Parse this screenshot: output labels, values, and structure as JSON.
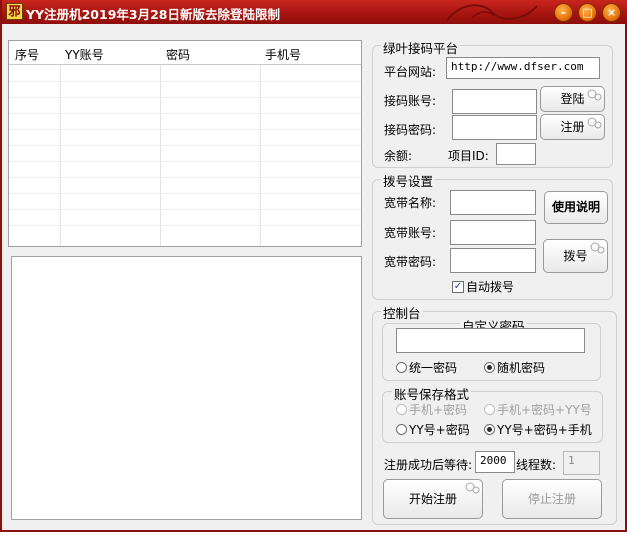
{
  "window": {
    "title": "YY注册机2019年3月28日新版去除登陆限制",
    "icon_glyph": "邪",
    "min_glyph": "–",
    "max_glyph": "□",
    "close_glyph": "×"
  },
  "grid": {
    "columns": [
      "序号",
      "YY账号",
      "密码",
      "手机号"
    ]
  },
  "platform": {
    "legend": "绿叶接码平台",
    "url_label": "平台网站:",
    "url_value": "http://www.dfser.com",
    "account_label": "接码账号:",
    "account_value": "",
    "password_label": "接码密码:",
    "password_value": "",
    "login_button": "登陆",
    "register_button": "注册",
    "balance_label": "余额:",
    "project_label": "项目ID:",
    "project_value": ""
  },
  "dial": {
    "legend": "拨号设置",
    "name_label": "宽带名称:",
    "account_label": "宽带账号:",
    "password_label": "宽带密码:",
    "help_button": "使用说明",
    "dial_button": "拨号",
    "auto_dial_label": "自动拨号",
    "auto_dial_checked": true,
    "check_glyph": "✓"
  },
  "console": {
    "legend": "控制台",
    "custom_password_label": "自定义密码",
    "custom_password_value": "",
    "uniform_password_label": "统一密码",
    "random_password_label": "随机密码",
    "password_mode": "random",
    "format_legend": "账号保存格式",
    "format_options": [
      "手机+密码",
      "手机+密码+YY号",
      "YY号+密码",
      "YY号+密码+手机"
    ],
    "format_selected": "YY号+密码+手机",
    "wait_label": "注册成功后等待:",
    "wait_value": "2000",
    "threads_label": "线程数:",
    "threads_value": "1",
    "start_button": "开始注册",
    "stop_button": "停止注册"
  }
}
